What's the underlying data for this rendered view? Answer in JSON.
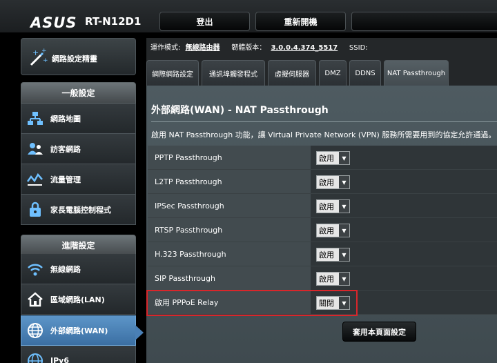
{
  "header": {
    "brand": "ASUS",
    "model": "RT-N12D1",
    "logout_label": "登出",
    "reboot_label": "重新開機"
  },
  "info": {
    "mode_label": "運作模式:",
    "mode_value": "無線路由器",
    "fw_label": "韌體版本：",
    "fw_value": "3.0.0.4.374_5517",
    "ssid_label": "SSID:"
  },
  "sidebar": {
    "qis_label": "網路設定精靈",
    "general_header": "一般設定",
    "general_items": [
      {
        "label": "網路地圖",
        "icon": "network-map-icon"
      },
      {
        "label": "訪客網路",
        "icon": "guest-network-icon"
      },
      {
        "label": "流量管理",
        "icon": "traffic-manager-icon"
      },
      {
        "label": "家長電腦控制程式",
        "icon": "parental-control-icon"
      }
    ],
    "advanced_header": "進階設定",
    "advanced_items": [
      {
        "label": "無線網路",
        "icon": "wireless-icon"
      },
      {
        "label": "區域網路(LAN)",
        "icon": "lan-home-icon"
      },
      {
        "label": "外部網路(WAN)",
        "icon": "wan-globe-icon",
        "active": true
      },
      {
        "label": "IPv6",
        "icon": "ipv6-globe-icon"
      }
    ]
  },
  "tabs": [
    {
      "label": "網際網路設定"
    },
    {
      "label": "通訊埠觸發程式"
    },
    {
      "label": "虛擬伺服器"
    },
    {
      "label": "DMZ"
    },
    {
      "label": "DDNS"
    },
    {
      "label": "NAT Passthrough",
      "active": true
    }
  ],
  "main": {
    "title": "外部網路(WAN) - NAT Passthrough",
    "description": "啟用 NAT Passthrough 功能，讓 Virtual Private Network (VPN) 服務所需要用到的協定允許通過。",
    "rows": [
      {
        "label": "PPTP Passthrough",
        "value": "啟用"
      },
      {
        "label": "L2TP Passthrough",
        "value": "啟用"
      },
      {
        "label": "IPSec Passthrough",
        "value": "啟用"
      },
      {
        "label": "RTSP Passthrough",
        "value": "啟用"
      },
      {
        "label": "H.323 Passthrough",
        "value": "啟用"
      },
      {
        "label": "SIP Passthrough",
        "value": "啟用"
      },
      {
        "label": "啟用 PPPoE Relay",
        "value": "關閉"
      }
    ],
    "apply_label": "套用本頁面設定"
  },
  "colors": {
    "active_nav": "#4a80b6",
    "highlight": "#d9262b"
  }
}
